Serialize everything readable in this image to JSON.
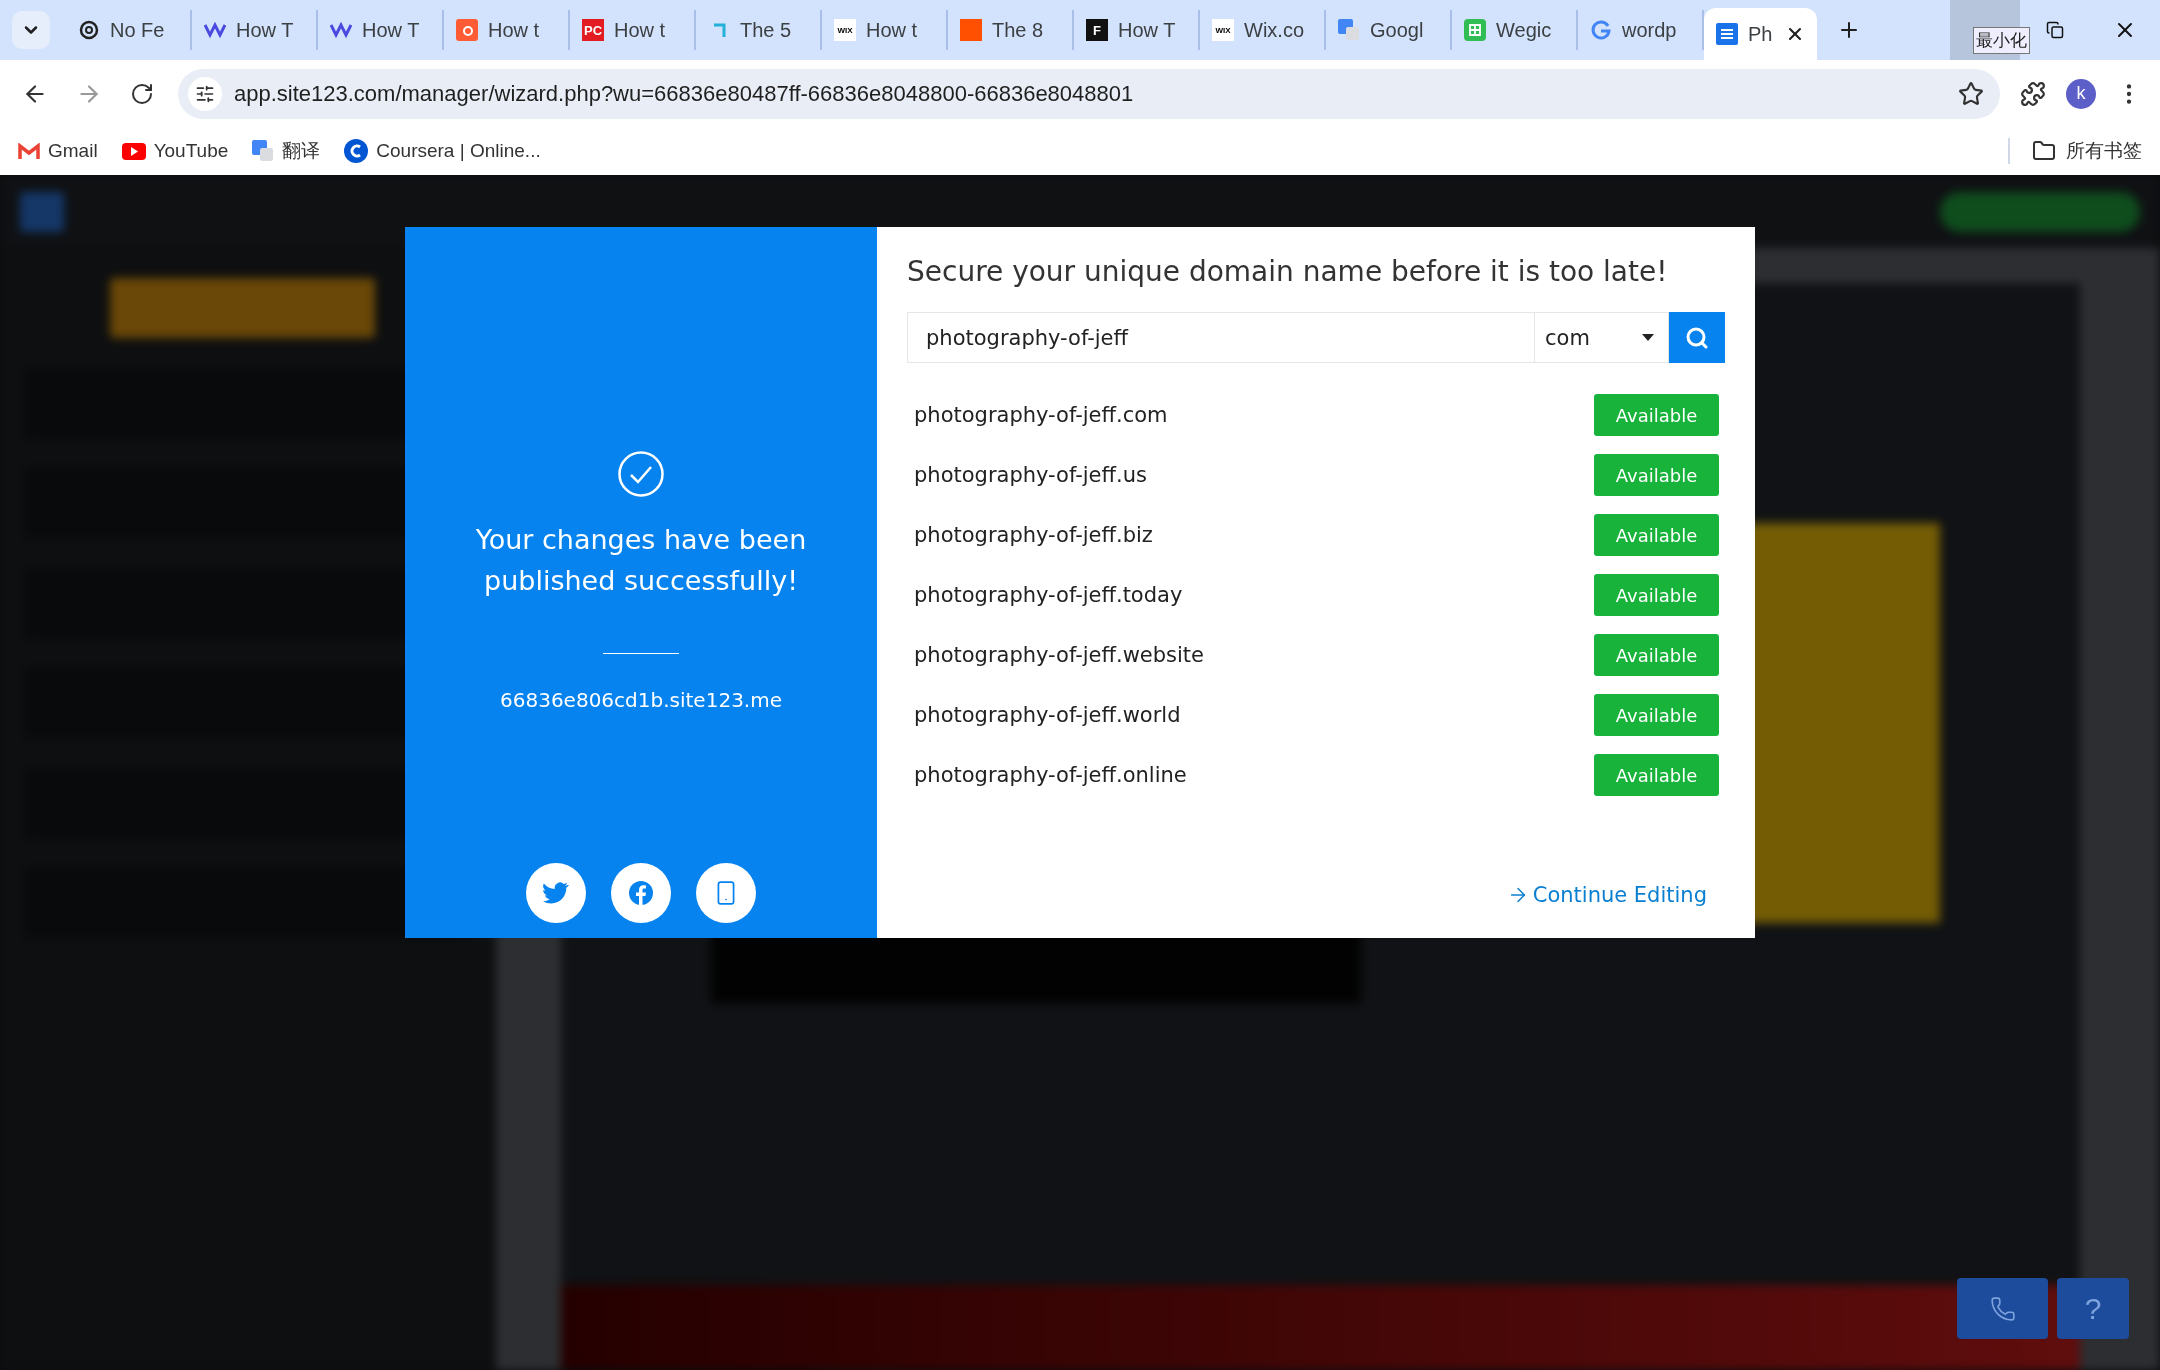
{
  "browser": {
    "tabs": [
      {
        "title": "No Fe",
        "kind": "knot",
        "selected": false
      },
      {
        "title": "How T",
        "kind": "wave",
        "selected": false
      },
      {
        "title": "How T",
        "kind": "wave",
        "selected": false
      },
      {
        "title": "How t",
        "kind": "sprocket",
        "selected": false
      },
      {
        "title": "How t",
        "kind": "letters",
        "glyph": "PC",
        "selected": false
      },
      {
        "title": "The 5",
        "kind": "hook",
        "selected": false
      },
      {
        "title": "How t",
        "kind": "letters",
        "glyph": "WIX",
        "selected": false
      },
      {
        "title": "The 8",
        "kind": "square",
        "selected": false
      },
      {
        "title": "How T",
        "kind": "letters",
        "glyph": "F",
        "selected": false
      },
      {
        "title": "Wix.co",
        "kind": "letters",
        "glyph": "WIX",
        "selected": false
      },
      {
        "title": "Googl",
        "kind": "translate",
        "selected": false
      },
      {
        "title": "Wegic",
        "kind": "grid",
        "selected": false
      },
      {
        "title": "wordp",
        "kind": "g",
        "selected": false
      },
      {
        "title": "Ph",
        "kind": "doc",
        "selected": true
      }
    ],
    "tooltip": "最小化",
    "url": "app.site123.com/manager/wizard.php?wu=66836e80487ff-66836e8048800-66836e8048801",
    "avatar": "k",
    "bookmarks": [
      {
        "label": "Gmail",
        "kind": "mail"
      },
      {
        "label": "YouTube",
        "kind": "play"
      },
      {
        "label": "翻译",
        "kind": "translate"
      },
      {
        "label": "Coursera | Online...",
        "kind": "ring"
      }
    ],
    "folder": "所有书签"
  },
  "modal": {
    "message": "Your changes have been published successfully!",
    "subdomain": "66836e806cd1b.site123.me",
    "share": [
      {
        "kind": "bird"
      },
      {
        "kind": "f"
      },
      {
        "kind": "phone"
      }
    ],
    "heading": "Secure your unique domain name before it is too late!",
    "search": {
      "value": "photography-of-jeff",
      "tld": "com"
    },
    "results": [
      {
        "domain": "photography-of-jeff.com",
        "status": "Available"
      },
      {
        "domain": "photography-of-jeff.us",
        "status": "Available"
      },
      {
        "domain": "photography-of-jeff.biz",
        "status": "Available"
      },
      {
        "domain": "photography-of-jeff.today",
        "status": "Available"
      },
      {
        "domain": "photography-of-jeff.website",
        "status": "Available"
      },
      {
        "domain": "photography-of-jeff.world",
        "status": "Available"
      },
      {
        "domain": "photography-of-jeff.online",
        "status": "Available"
      }
    ],
    "continue": "Continue Editing"
  },
  "help": "?"
}
